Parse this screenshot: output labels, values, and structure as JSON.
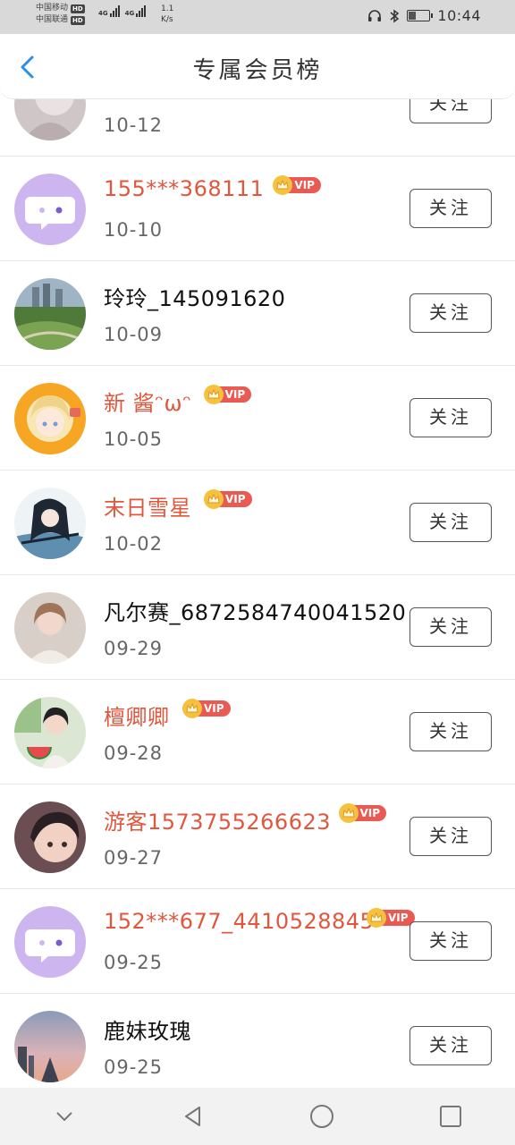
{
  "status_bar": {
    "carrier1": "中国移动",
    "carrier2": "中国联通",
    "hd": "HD",
    "net1": "4G",
    "net2": "4G",
    "speed_value": "1.1",
    "speed_unit": "K/s",
    "time": "10:44",
    "icons": [
      "headphone-icon",
      "bluetooth-icon",
      "battery-icon"
    ]
  },
  "header": {
    "title": "专属会员榜",
    "back_icon": "chevron-left-icon"
  },
  "colors": {
    "vip_name": "#e0573d",
    "vip_badge": "#e85a52",
    "crown": "#f6c23e",
    "back_icon": "#2a8fe6"
  },
  "vip_badge_text": "VIP",
  "members": [
    {
      "name": "",
      "date": "10-12",
      "vip": false,
      "follow_label": "关注",
      "avatar": "photo-avatar"
    },
    {
      "name": "155***368111",
      "date": "10-10",
      "vip": true,
      "follow_label": "关注",
      "avatar": "default-chat-avatar"
    },
    {
      "name": "玲玲_145091620",
      "date": "10-09",
      "vip": false,
      "follow_label": "关注",
      "avatar": "landscape-avatar"
    },
    {
      "name": "新 酱ᵔωᵔ",
      "date": "10-05",
      "vip": true,
      "follow_label": "关注",
      "avatar": "anime-girl-avatar"
    },
    {
      "name": "末日雪星",
      "date": "10-02",
      "vip": true,
      "follow_label": "关注",
      "avatar": "anime-boy-avatar"
    },
    {
      "name": "凡尔赛_6872584740041520",
      "date": "09-29",
      "vip": false,
      "follow_label": "关注",
      "avatar": "girl-photo-avatar"
    },
    {
      "name": "檀卿卿",
      "date": "09-28",
      "vip": true,
      "follow_label": "关注",
      "avatar": "woman-watermelon-avatar"
    },
    {
      "name": "游客1573755266623",
      "date": "09-27",
      "vip": true,
      "follow_label": "关注",
      "avatar": "child-photo-avatar"
    },
    {
      "name": "152***677_4410528845",
      "date": "09-25",
      "vip": true,
      "follow_label": "关注",
      "avatar": "default-chat-avatar"
    },
    {
      "name": "鹿妹玫瑰",
      "date": "09-25",
      "vip": false,
      "follow_label": "关注",
      "avatar": "sunset-avatar"
    }
  ],
  "nav_bar": {
    "buttons": [
      "collapse-icon",
      "back-triangle-icon",
      "home-circle-icon",
      "recents-square-icon"
    ]
  }
}
